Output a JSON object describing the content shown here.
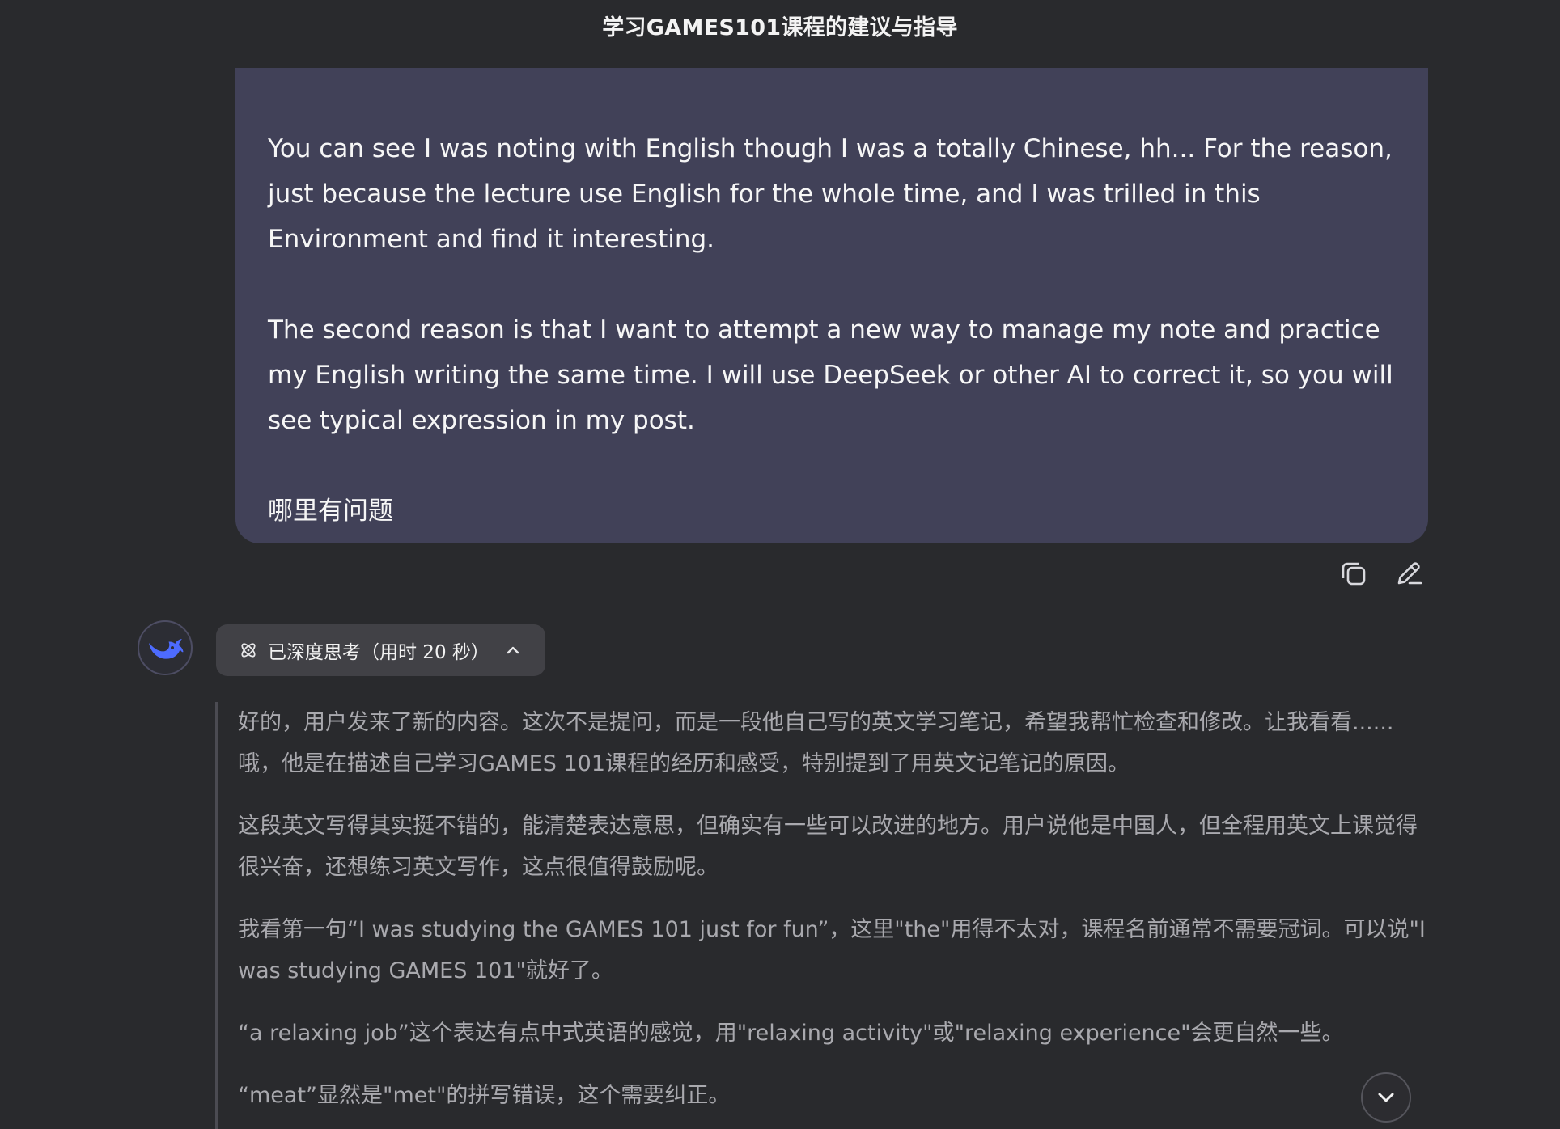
{
  "header": {
    "title": "学习GAMES101课程的建议与指导"
  },
  "user_message": {
    "paragraphs": [
      "You can see I was noting with English though I was a totally Chinese, hh... For the reason, just because the lecture use English for the whole time, and I was trilled in this Environment and find it interesting.",
      "The second reason is that I want to attempt a new way to manage my note and practice my English writing the same time. I will use DeepSeek or other AI to correct it, so you will see typical expression in my post.",
      "哪里有问题"
    ],
    "actions": {
      "copy_icon": "copy-icon",
      "edit_icon": "edit-icon"
    }
  },
  "assistant": {
    "avatar_icon": "whale-logo-icon",
    "thinking_toggle": {
      "label": "已深度思考（用时 20 秒）",
      "icon": "atom-icon",
      "chevron": "chevron-up-icon"
    },
    "thinking_paragraphs": [
      "好的，用户发来了新的内容。这次不是提问，而是一段他自己写的英文学习笔记，希望我帮忙检查和修改。让我看看......哦，他是在描述自己学习GAMES 101课程的经历和感受，特别提到了用英文记笔记的原因。",
      "这段英文写得其实挺不错的，能清楚表达意思，但确实有一些可以改进的地方。用户说他是中国人，但全程用英文上课觉得很兴奋，还想练习英文写作，这点很值得鼓励呢。",
      "我看第一句“I was studying the GAMES 101 just for fun”，这里\"the\"用得不太对，课程名前通常不需要冠词。可以说\"I was studying GAMES 101\"就好了。",
      "“a relaxing job”这个表达有点中式英语的感觉，用\"relaxing activity\"或\"relaxing experience\"会更自然一些。",
      "“meat”显然是\"met\"的拼写错误，这个需要纠正。"
    ]
  },
  "scroll_button": {
    "icon": "chevron-down-icon"
  },
  "colors": {
    "background": "#292a2d",
    "user_bubble": "#414158",
    "thinking_toggle_bg": "#414146",
    "thinking_text": "#a9a9ae",
    "accent_blue": "#4d6bfe"
  }
}
